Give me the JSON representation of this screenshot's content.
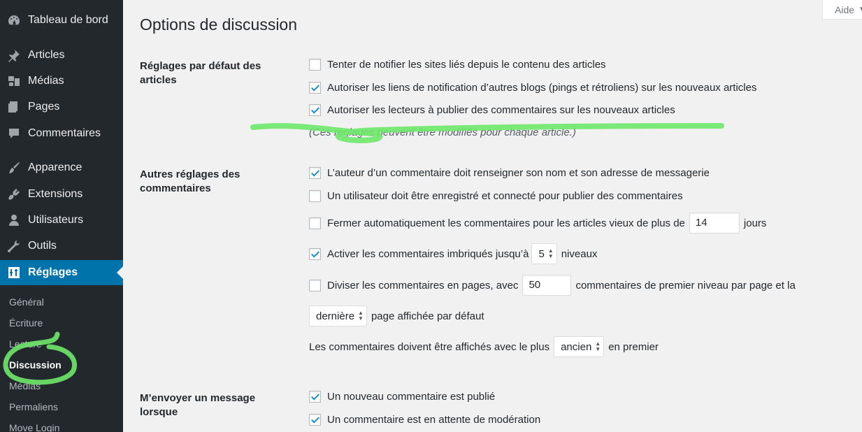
{
  "sidebar": {
    "items": [
      {
        "label": "Tableau de bord",
        "icon": "dashboard-icon"
      },
      {
        "label": "Articles",
        "icon": "pushpin-icon"
      },
      {
        "label": "Médias",
        "icon": "media-icon"
      },
      {
        "label": "Pages",
        "icon": "pages-icon"
      },
      {
        "label": "Commentaires",
        "icon": "comment-icon"
      },
      {
        "label": "Apparence",
        "icon": "brush-icon"
      },
      {
        "label": "Extensions",
        "icon": "plugin-icon"
      },
      {
        "label": "Utilisateurs",
        "icon": "user-icon"
      },
      {
        "label": "Outils",
        "icon": "wrench-icon"
      },
      {
        "label": "Réglages",
        "icon": "settings-icon"
      }
    ],
    "submenu": [
      "Général",
      "Écriture",
      "Lecture",
      "Discussion",
      "Médias",
      "Permaliens",
      "Move Login"
    ]
  },
  "help_tab": {
    "label": "Aide"
  },
  "page": {
    "title": "Options de discussion"
  },
  "sections": {
    "default_settings": {
      "label": "Réglages par défaut des articles",
      "options": [
        {
          "label": "Tenter de notifier les sites liés depuis le contenu des articles",
          "checked": false
        },
        {
          "label": "Autoriser les liens de notification d’autres blogs (pings et rétroliens) sur les nouveaux articles",
          "checked": true
        },
        {
          "label": "Autoriser les lecteurs à publier des commentaires sur les nouveaux articles",
          "checked": true
        }
      ],
      "note": "(Ces réglages peuvent être modifiés pour chaque article.)"
    },
    "other_comment_settings": {
      "label": "Autres réglages des commentaires",
      "require_name_email": {
        "label": "L’auteur d’un commentaire doit renseigner son nom et son adresse de messagerie",
        "checked": true
      },
      "registration_required": {
        "label": "Un utilisateur doit être enregistré et connecté pour publier des commentaires",
        "checked": false
      },
      "close_comments": {
        "label_before": "Fermer automatiquement les commentaires pour les articles vieux de plus de",
        "value": "14",
        "label_after": "jours",
        "checked": false
      },
      "thread_comments": {
        "label_before": "Activer les commentaires imbriqués jusqu’à",
        "value": "5",
        "label_after": "niveaux",
        "checked": true
      },
      "page_comments": {
        "label_before": "Diviser les commentaires en pages, avec",
        "value": "50",
        "label_after": "commentaires de premier niveau par page et la",
        "checked": false
      },
      "default_page": {
        "value": "dernière",
        "label_after": "page affichée par défaut"
      },
      "comment_order": {
        "label_before": "Les commentaires doivent être affichés avec le plus",
        "value": "ancien",
        "label_after": "en premier"
      }
    },
    "email_me": {
      "label": "M’envoyer un message lorsque",
      "options": [
        {
          "label": "Un nouveau commentaire est publié",
          "checked": true
        },
        {
          "label": "Un commentaire est en attente de modération",
          "checked": true
        }
      ]
    }
  },
  "colors": {
    "sidebar_bg": "#23282d",
    "active_bg": "#0073aa",
    "highlighter": "#6ee86a",
    "checkmark": "#1e8cbe"
  }
}
